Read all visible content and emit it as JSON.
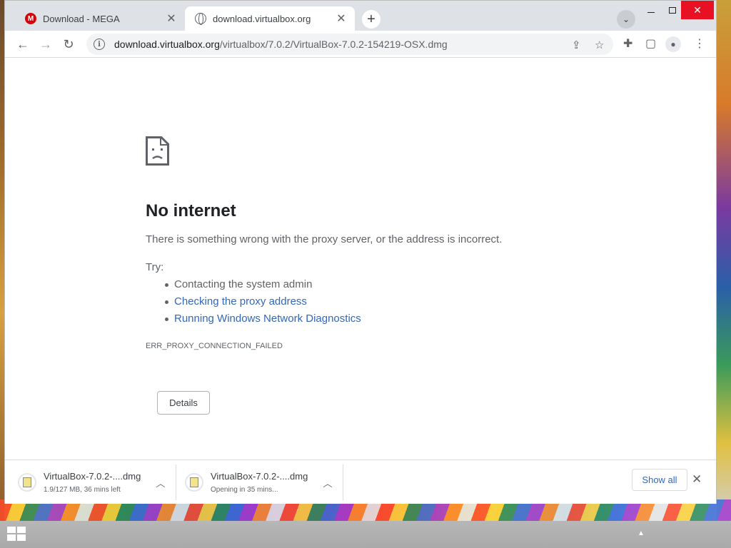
{
  "tabs": [
    {
      "title": "Download - MEGA",
      "favicon": "mega-icon",
      "active": false
    },
    {
      "title": "download.virtualbox.org",
      "favicon": "globe-icon",
      "active": true
    }
  ],
  "toolbar": {
    "url_host": "download.virtualbox.org",
    "url_path": "/virtualbox/7.0.2/VirtualBox-7.0.2-154219-OSX.dmg"
  },
  "error_page": {
    "icon": "sad-page-icon",
    "title": "No internet",
    "description": "There is something wrong with the proxy server, or the address is incorrect.",
    "try_label": "Try:",
    "suggestions": [
      {
        "text": "Contacting the system admin",
        "link": false
      },
      {
        "text": "Checking the proxy address",
        "link": true
      },
      {
        "text": "Running Windows Network Diagnostics",
        "link": true
      }
    ],
    "error_code": "ERR_PROXY_CONNECTION_FAILED",
    "details_label": "Details"
  },
  "downloads": [
    {
      "name": "VirtualBox-7.0.2-....dmg",
      "status": "1.9/127 MB, 36 mins left"
    },
    {
      "name": "VirtualBox-7.0.2-....dmg",
      "status": "Opening in 35 mins..."
    }
  ],
  "shelf": {
    "show_all_label": "Show all"
  },
  "colors": {
    "accent_link": "#3367b8",
    "close_red": "#e81123",
    "mega_red": "#d90007"
  }
}
